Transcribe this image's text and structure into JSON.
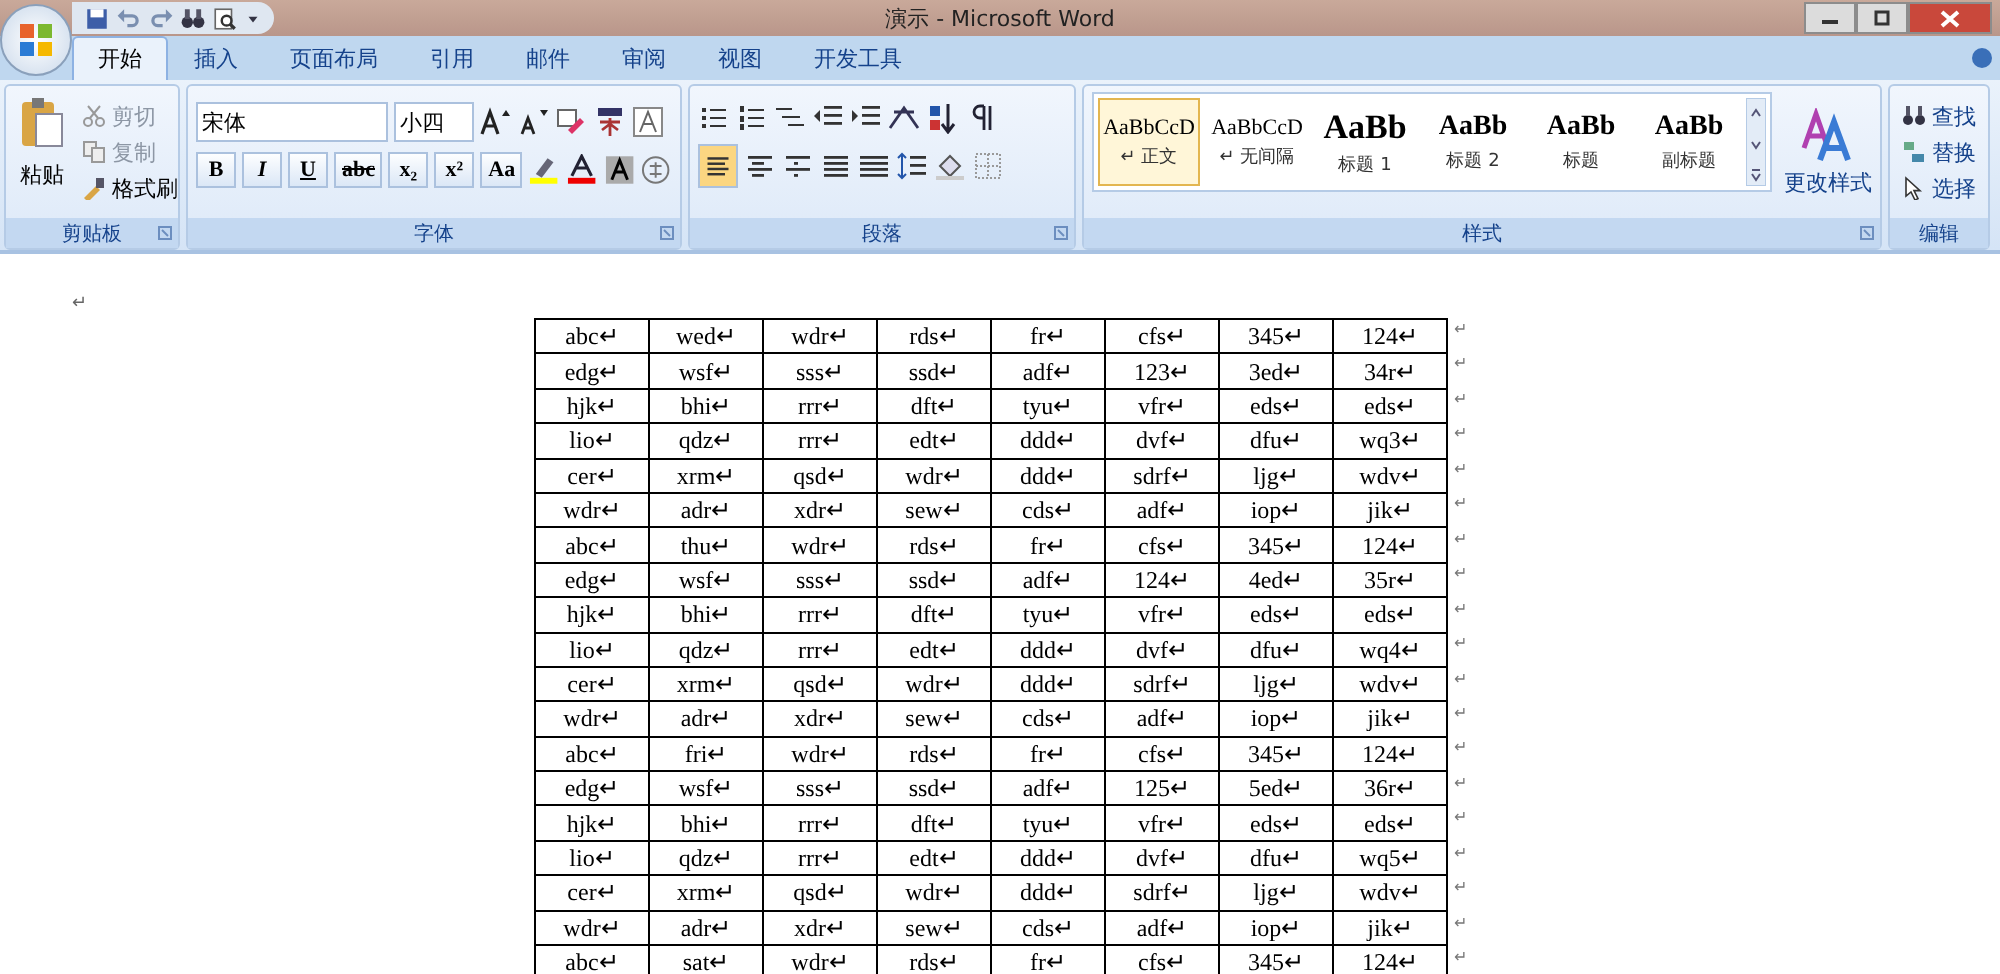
{
  "window": {
    "title": "演示 - Microsoft Word"
  },
  "tabs": [
    {
      "label": "开始",
      "selected": true
    },
    {
      "label": "插入",
      "selected": false
    },
    {
      "label": "页面布局",
      "selected": false
    },
    {
      "label": "引用",
      "selected": false
    },
    {
      "label": "邮件",
      "selected": false
    },
    {
      "label": "审阅",
      "selected": false
    },
    {
      "label": "视图",
      "selected": false
    },
    {
      "label": "开发工具",
      "selected": false
    }
  ],
  "clipboard": {
    "paste": "粘贴",
    "items": [
      {
        "label": "剪切",
        "disabled": true
      },
      {
        "label": "复制",
        "disabled": true
      },
      {
        "label": "格式刷",
        "disabled": false
      }
    ],
    "group_label": "剪贴板"
  },
  "font": {
    "font_name": "宋体",
    "font_size": "小四",
    "format_buttons": [
      "B",
      "I",
      "U",
      "abc",
      "x₂",
      "x²",
      "Aa"
    ],
    "group_label": "字体"
  },
  "paragraph": {
    "group_label": "段落"
  },
  "styles": {
    "items": [
      {
        "preview": "AaBbCcD",
        "name": "↵ 正文",
        "selected": true
      },
      {
        "preview": "AaBbCcD",
        "name": "↵ 无间隔",
        "selected": false
      },
      {
        "preview": "AaBb",
        "name": "标题 1",
        "selected": false
      },
      {
        "preview": "AaBb",
        "name": "标题 2",
        "selected": false
      },
      {
        "preview": "AaBb",
        "name": "标题",
        "selected": false
      },
      {
        "preview": "AaBb",
        "name": "副标题",
        "selected": false
      }
    ],
    "change_styles": "更改样式",
    "group_label": "样式"
  },
  "editing": {
    "items": [
      "查找",
      "替换",
      "选择"
    ],
    "group_label": "编辑"
  },
  "document": {
    "paragraph_mark": "↵",
    "table": {
      "rows": [
        [
          "abc↵",
          "wed↵",
          "wdr↵",
          "rds↵",
          "fr↵",
          "cfs↵",
          "345↵",
          "124↵"
        ],
        [
          "edg↵",
          "wsf↵",
          "sss↵",
          "ssd↵",
          "adf↵",
          "123↵",
          "3ed↵",
          "34r↵"
        ],
        [
          "hjk↵",
          "bhi↵",
          "rrr↵",
          "dft↵",
          "tyu↵",
          "vfr↵",
          "eds↵",
          "eds↵"
        ],
        [
          "lio↵",
          "qdz↵",
          "rrr↵",
          "edt↵",
          "ddd↵",
          "dvf↵",
          "dfu↵",
          "wq3↵"
        ],
        [
          "cer↵",
          "xrm↵",
          "qsd↵",
          "wdr↵",
          "ddd↵",
          "sdrf↵",
          "ljg↵",
          "wdv↵"
        ],
        [
          "wdr↵",
          "adr↵",
          "xdr↵",
          "sew↵",
          "cds↵",
          "adf↵",
          "iop↵",
          "jik↵"
        ],
        [
          "abc↵",
          "thu↵",
          "wdr↵",
          "rds↵",
          "fr↵",
          "cfs↵",
          "345↵",
          "124↵"
        ],
        [
          "edg↵",
          "wsf↵",
          "sss↵",
          "ssd↵",
          "adf↵",
          "124↵",
          "4ed↵",
          "35r↵"
        ],
        [
          "hjk↵",
          "bhi↵",
          "rrr↵",
          "dft↵",
          "tyu↵",
          "vfr↵",
          "eds↵",
          "eds↵"
        ],
        [
          "lio↵",
          "qdz↵",
          "rrr↵",
          "edt↵",
          "ddd↵",
          "dvf↵",
          "dfu↵",
          "wq4↵"
        ],
        [
          "cer↵",
          "xrm↵",
          "qsd↵",
          "wdr↵",
          "ddd↵",
          "sdrf↵",
          "ljg↵",
          "wdv↵"
        ],
        [
          "wdr↵",
          "adr↵",
          "xdr↵",
          "sew↵",
          "cds↵",
          "adf↵",
          "iop↵",
          "jik↵"
        ],
        [
          "abc↵",
          "fri↵",
          "wdr↵",
          "rds↵",
          "fr↵",
          "cfs↵",
          "345↵",
          "124↵"
        ],
        [
          "edg↵",
          "wsf↵",
          "sss↵",
          "ssd↵",
          "adf↵",
          "125↵",
          "5ed↵",
          "36r↵"
        ],
        [
          "hjk↵",
          "bhi↵",
          "rrr↵",
          "dft↵",
          "tyu↵",
          "vfr↵",
          "eds↵",
          "eds↵"
        ],
        [
          "lio↵",
          "qdz↵",
          "rrr↵",
          "edt↵",
          "ddd↵",
          "dvf↵",
          "dfu↵",
          "wq5↵"
        ],
        [
          "cer↵",
          "xrm↵",
          "qsd↵",
          "wdr↵",
          "ddd↵",
          "sdrf↵",
          "ljg↵",
          "wdv↵"
        ],
        [
          "wdr↵",
          "adr↵",
          "xdr↵",
          "sew↵",
          "cds↵",
          "adf↵",
          "iop↵",
          "jik↵"
        ],
        [
          "abc↵",
          "sat↵",
          "wdr↵",
          "rds↵",
          "fr↵",
          "cfs↵",
          "345↵",
          "124↵"
        ]
      ],
      "row_end_mark": "↵"
    }
  }
}
